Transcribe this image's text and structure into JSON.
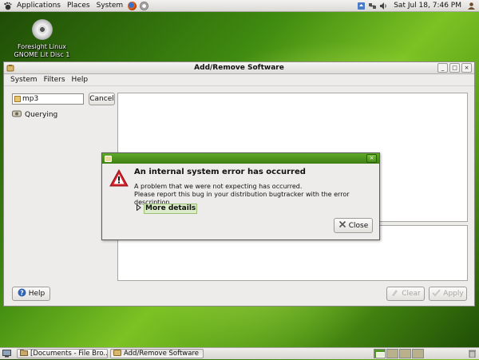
{
  "top_panel": {
    "menus": [
      "Applications",
      "Places",
      "System"
    ],
    "clock": "Sat Jul 18,  7:46 PM"
  },
  "desktop": {
    "icon_label_line1": "Foresight Linux",
    "icon_label_line2": "GNOME Lit Disc 1"
  },
  "window": {
    "title": "Add/Remove Software",
    "menus": [
      "System",
      "Filters",
      "Help"
    ],
    "search_value": "mp3",
    "cancel_label": "Cancel",
    "status_text": "Querying",
    "help_label": "Help",
    "clear_label": "Clear",
    "apply_label": "Apply"
  },
  "dialog": {
    "heading": "An internal system error has occurred",
    "line1": "A problem that we were not expecting has occurred.",
    "line2": "Please report this bug in your distribution bugtracker with the error description.",
    "details_label": "More details",
    "close_label": "Close"
  },
  "taskbar": {
    "tasks": [
      "[Documents - File Bro...",
      "Add/Remove Software"
    ]
  },
  "colors": {
    "dialog_title": "#4e951f",
    "warning": "#c8202a",
    "desktop_green": "#5aa51a"
  }
}
